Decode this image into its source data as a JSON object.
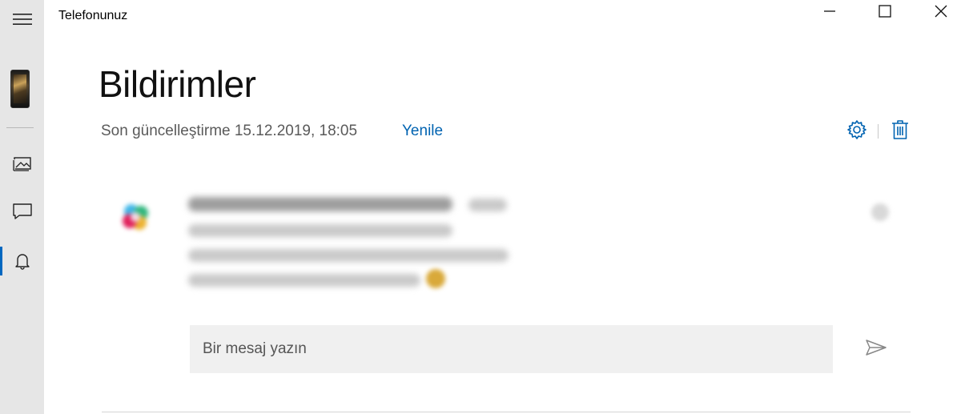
{
  "window": {
    "title": "Telefonunuz",
    "controls": [
      "minimize-icon",
      "maximize-icon",
      "close-icon"
    ]
  },
  "sidebar": {
    "items": [
      {
        "name": "menu",
        "icon": "hamburger-menu-icon"
      },
      {
        "name": "phone",
        "icon": "phone-thumbnail"
      },
      {
        "name": "photos",
        "icon": "photos-icon"
      },
      {
        "name": "messages",
        "icon": "chat-icon"
      },
      {
        "name": "notifications",
        "icon": "bell-icon",
        "active": true
      }
    ]
  },
  "main": {
    "title": "Bildirimler",
    "last_updated": "Son güncelleştirme 15.12.2019, 18:05",
    "refresh_label": "Yenile",
    "toolbar": {
      "settings_icon": "gear-icon",
      "clear_icon": "trash-icon"
    }
  },
  "reply": {
    "placeholder": "Bir mesaj yazın",
    "send_icon": "send-icon"
  },
  "colors": {
    "accent": "#0063b1",
    "sidebar_bg": "#e6e6e6",
    "input_bg": "#f0f0f0"
  }
}
